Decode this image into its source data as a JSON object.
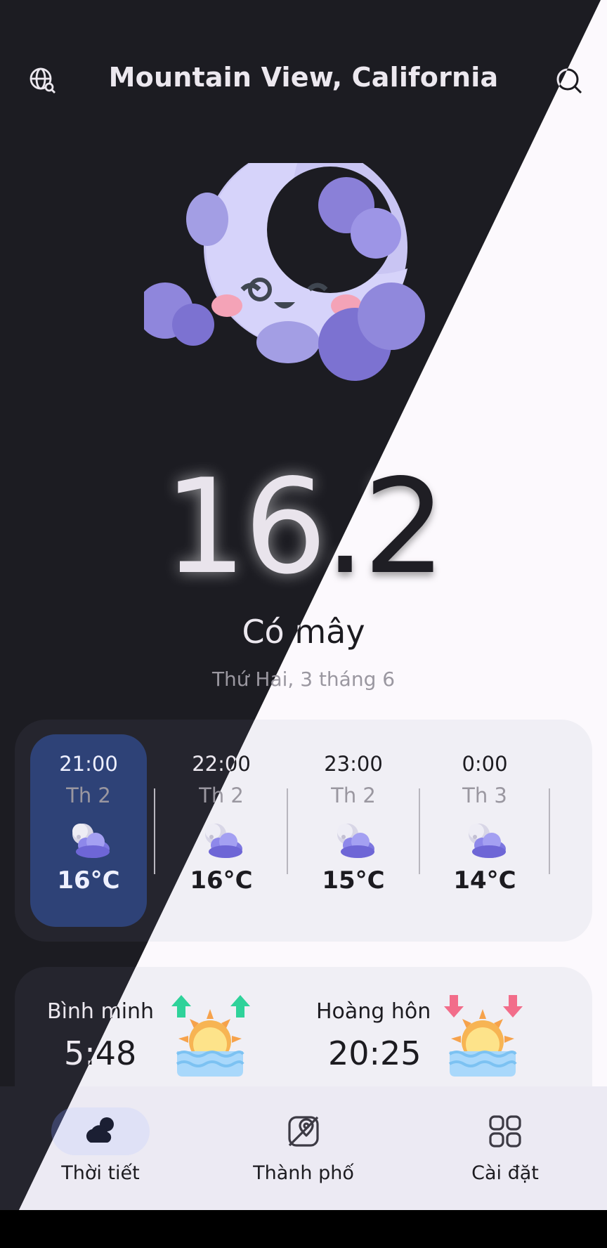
{
  "header": {
    "city": "Mountain View, California",
    "left_icon": "globe-search-icon",
    "right_icon": "search-icon"
  },
  "current": {
    "icon": "moon-cloud-icon",
    "temperature": "16.2",
    "condition": "Có mây",
    "date": "Thứ Hai, 3 tháng 6"
  },
  "hourly": [
    {
      "time": "21:00",
      "day": "Th 2",
      "temp": "16°C",
      "icon": "moon-cloud-icon",
      "active": true
    },
    {
      "time": "22:00",
      "day": "Th 2",
      "temp": "16°C",
      "icon": "moon-cloud-icon",
      "active": false
    },
    {
      "time": "23:00",
      "day": "Th 2",
      "temp": "15°C",
      "icon": "moon-cloud-icon",
      "active": false
    },
    {
      "time": "0:00",
      "day": "Th 3",
      "temp": "14°C",
      "icon": "moon-cloud-icon",
      "active": false
    }
  ],
  "sun": {
    "sunrise_label": "Bình minh",
    "sunrise_time": "5:48",
    "sunset_label": "Hoàng hôn",
    "sunset_time": "20:25",
    "sunrise_icon": "sunrise-icon",
    "sunset_icon": "sunset-icon"
  },
  "nav": [
    {
      "label": "Thời tiết",
      "icon": "weather-cloud-icon",
      "selected": true
    },
    {
      "label": "Thành phố",
      "icon": "city-map-icon",
      "selected": false
    },
    {
      "label": "Cài đặt",
      "icon": "settings-grid-icon",
      "selected": false
    }
  ],
  "colors": {
    "dark_bg": "#1c1c22",
    "light_bg": "#fcf9fd",
    "active_hour": "#2e4277",
    "nav_pill": "#dfe1f6",
    "accent_purple": "#7b71d3"
  }
}
